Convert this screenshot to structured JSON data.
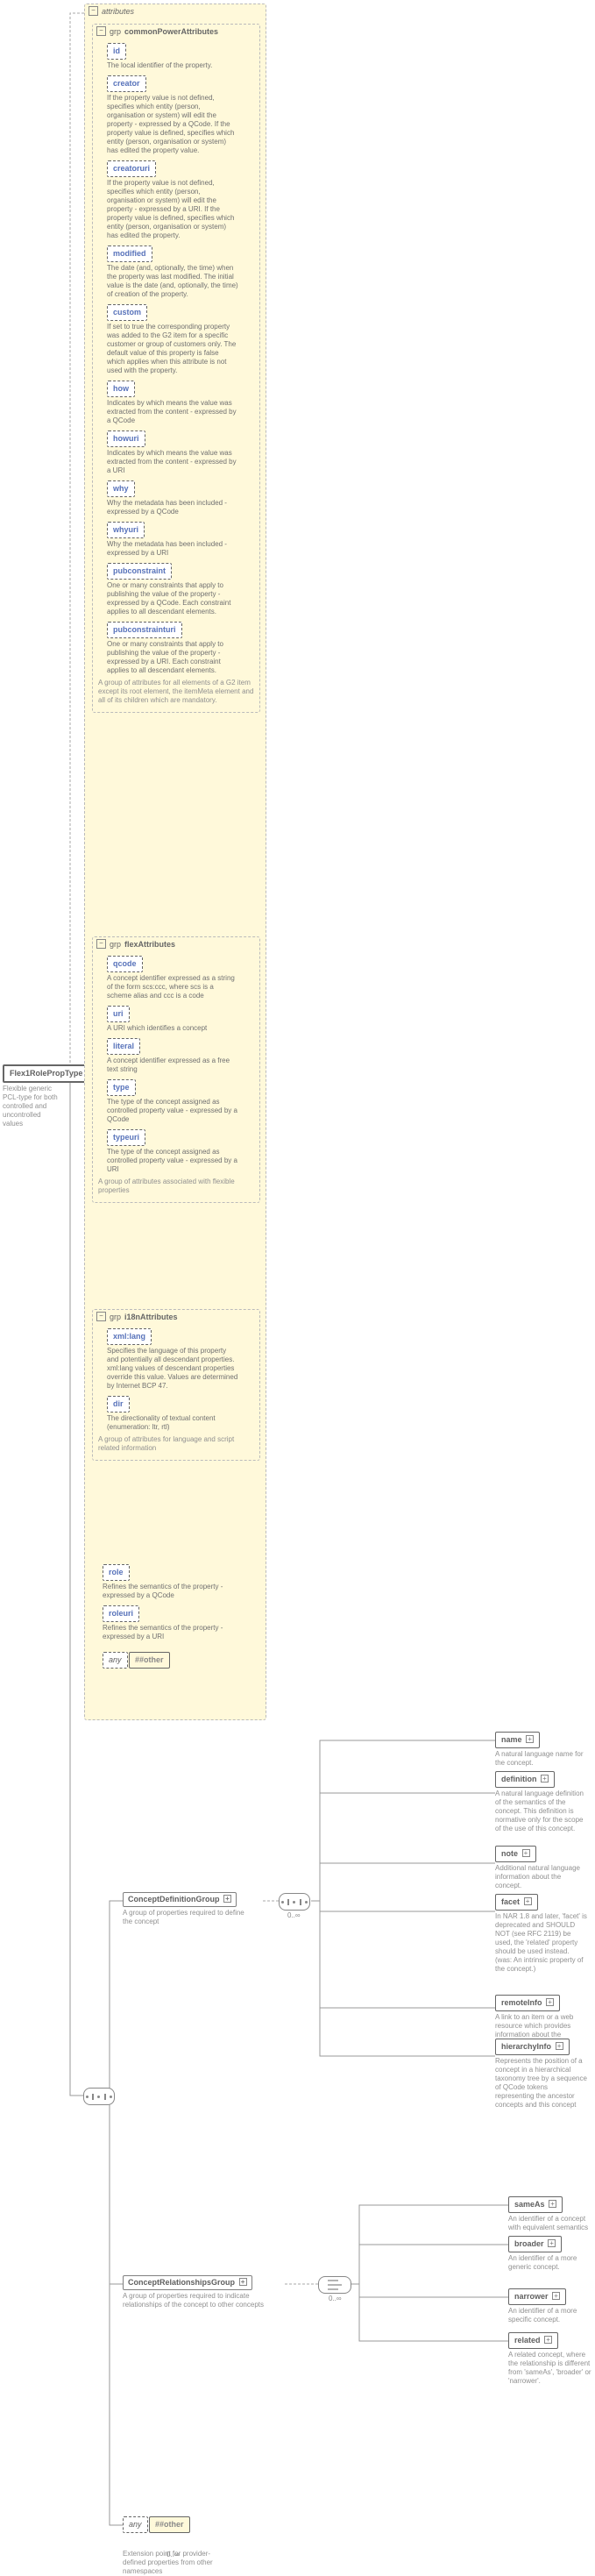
{
  "attrHeader": "attributes",
  "commonPower": {
    "title": "commonPowerAttributes",
    "tag": "grp",
    "footer": "A group of attributes for all elements of a G2 item except its root element, the itemMeta element and all of its children which are mandatory.",
    "items": [
      {
        "name": "id",
        "desc": "The local identifier of the property."
      },
      {
        "name": "creator",
        "desc": "If the property value is not defined, specifies which entity (person, organisation or system) will edit the property - expressed by a QCode. If the property value is defined, specifies which entity (person, organisation or system) has edited the property value."
      },
      {
        "name": "creatoruri",
        "desc": "If the property value is not defined, specifies which entity (person, organisation or system) will edit the property - expressed by a URI. If the property value is defined, specifies which entity (person, organisation or system) has edited the property."
      },
      {
        "name": "modified",
        "desc": "The date (and, optionally, the time) when the property was last modified. The initial value is the date (and, optionally, the time) of creation of the property."
      },
      {
        "name": "custom",
        "desc": "If set to true the corresponding property was added to the G2 item for a specific customer or group of customers only. The default value of this property is false which applies when this attribute is not used with the property."
      },
      {
        "name": "how",
        "desc": "Indicates by which means the value was extracted from the content - expressed by a QCode"
      },
      {
        "name": "howuri",
        "desc": "Indicates by which means the value was extracted from the content - expressed by a URI"
      },
      {
        "name": "why",
        "desc": "Why the metadata has been included - expressed by a QCode"
      },
      {
        "name": "whyuri",
        "desc": "Why the metadata has been included - expressed by a URI"
      },
      {
        "name": "pubconstraint",
        "desc": "One or many constraints that apply to publishing the value of the property - expressed by a QCode. Each constraint applies to all descendant elements."
      },
      {
        "name": "pubconstrainturi",
        "desc": "One or many constraints that apply to publishing the value of the property - expressed by a URI. Each constraint applies to all descendant elements."
      }
    ]
  },
  "flex": {
    "title": "flexAttributes",
    "tag": "grp",
    "footer": "A group of attributes associated with flexible properties",
    "items": [
      {
        "name": "qcode",
        "desc": "A concept identifier expressed as a string of the form scs:ccc, where scs is a scheme alias and ccc is a code"
      },
      {
        "name": "uri",
        "desc": "A URI which identifies a concept"
      },
      {
        "name": "literal",
        "desc": "A concept identifier expressed as a free text string"
      },
      {
        "name": "type",
        "desc": "The type of the concept assigned as controlled property value - expressed by a QCode"
      },
      {
        "name": "typeuri",
        "desc": "The type of the concept assigned as controlled property value - expressed by a URI"
      }
    ]
  },
  "i18n": {
    "title": "i18nAttributes",
    "tag": "grp",
    "footer": "A group of attributes for language and script related information",
    "items": [
      {
        "name": "xml:lang",
        "desc": "Specifies the language of this property and potentially all descendant properties. xml:lang values of descendant properties override this value. Values are determined by Internet BCP 47."
      },
      {
        "name": "dir",
        "desc": "The directionality of textual content (enumeration: ltr, rtl)"
      }
    ]
  },
  "others": [
    {
      "name": "role",
      "desc": "Refines the semantics of the property - expressed by a QCode"
    },
    {
      "name": "roleuri",
      "desc": "Refines the semantics of the property - expressed by a URI"
    }
  ],
  "anyOther": "##other",
  "anyLabel": "any",
  "root": {
    "name": "Flex1RolePropType",
    "desc": "Flexible generic PCL-type for both controlled and uncontrolled values"
  },
  "cdg": {
    "name": "ConceptDefinitionGroup",
    "desc": "A group of properties required to define the concept",
    "items": [
      {
        "name": "name",
        "desc": "A natural language name for the concept.",
        "icon": "+"
      },
      {
        "name": "definition",
        "desc": "A natural language definition of the semantics of the concept. This definition is normative only for the scope of the use of this concept.",
        "icon": "+"
      },
      {
        "name": "note",
        "desc": "Additional natural language information about the concept.",
        "icon": "+"
      },
      {
        "name": "facet",
        "desc": "In NAR 1.8 and later, 'facet' is deprecated and SHOULD NOT (see RFC 2119) be used, the 'related' property should be used instead. (was: An intrinsic property of the concept.)",
        "icon": "+"
      },
      {
        "name": "remoteInfo",
        "desc": "A link to an item or a web resource which provides information about the concept",
        "icon": "+"
      },
      {
        "name": "hierarchyInfo",
        "desc": "Represents the position of a concept in a hierarchical taxonomy tree by a sequence of QCode tokens representing the ancestor concepts and this concept",
        "icon": "+"
      }
    ]
  },
  "crg": {
    "name": "ConceptRelationshipsGroup",
    "desc": "A group of properties required to indicate relationships of the concept to other concepts",
    "items": [
      {
        "name": "sameAs",
        "desc": "An identifier of a concept with equivalent semantics",
        "icon": "+"
      },
      {
        "name": "broader",
        "desc": "An identifier of a more generic concept.",
        "icon": "+"
      },
      {
        "name": "narrower",
        "desc": "An identifier of a more specific concept.",
        "icon": "+"
      },
      {
        "name": "related",
        "desc": "A related concept, where the relationship is different from 'sameAs', 'broader' or 'narrower'.",
        "icon": "+"
      }
    ]
  },
  "mult": "0..∞",
  "bottom": {
    "name": "##other",
    "desc": "Extension point for provider-defined properties from other namespaces"
  }
}
